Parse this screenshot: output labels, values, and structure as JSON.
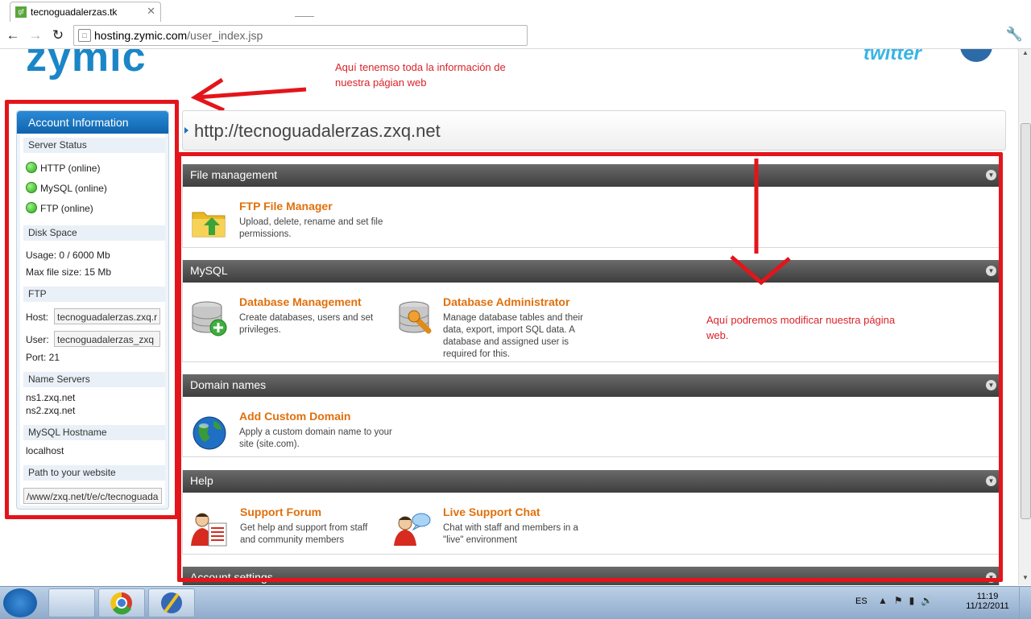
{
  "browser": {
    "tab_title": "tecnoguadalerzas.tk",
    "url_host": "hosting.zymic.com",
    "url_path": "/user_index.jsp"
  },
  "header": {
    "logo_text": "zymic",
    "twitter_text": "twitter"
  },
  "sidebar": {
    "title": "Account Information",
    "server_status_label": "Server Status",
    "services": [
      "HTTP (online)",
      "MySQL (online)",
      "FTP (online)"
    ],
    "disk_space_label": "Disk Space",
    "usage": "Usage:  0 / 6000 Mb",
    "max_file_size": "Max file size:  15 Mb",
    "ftp_label": "FTP",
    "host_label": "Host:",
    "host_value": "tecnoguadalerzas.zxq.r",
    "user_label": "User:",
    "user_value": "tecnoguadalerzas_zxq",
    "port": "Port:  21",
    "name_servers_label": "Name Servers",
    "ns1": "ns1.zxq.net",
    "ns2": "ns2.zxq.net",
    "mysql_hostname_label": "MySQL Hostname",
    "mysql_hostname": "localhost",
    "path_label": "Path to your website",
    "path_value": "/www/zxq.net/t/e/c/tecnoguada"
  },
  "main": {
    "site_url": "http://tecnoguadalerzas.zxq.net",
    "sections": {
      "file_management": {
        "title": "File management",
        "items": [
          {
            "title": "FTP File Manager",
            "desc": "Upload, delete, rename and set file permissions."
          }
        ]
      },
      "mysql": {
        "title": "MySQL",
        "items": [
          {
            "title": "Database Management",
            "desc": "Create databases, users and set privileges."
          },
          {
            "title": "Database Administrator",
            "desc": "Manage database tables and their data, export, import SQL data. A database and assigned user is required for this."
          }
        ]
      },
      "domain_names": {
        "title": "Domain names",
        "items": [
          {
            "title": "Add Custom Domain",
            "desc": "Apply a custom domain name to your site (site.com)."
          }
        ]
      },
      "help": {
        "title": "Help",
        "items": [
          {
            "title": "Support Forum",
            "desc": "Get help and support from staff and community members"
          },
          {
            "title": "Live Support Chat",
            "desc": "Chat with staff and members in a \"live\" environment"
          }
        ]
      },
      "account_settings": {
        "title": "Account settings"
      }
    }
  },
  "annotations": {
    "top": "Aquí tenemso toda la información de nuestra págian web",
    "right": "Aquí podremos modificar nuestra página web."
  },
  "taskbar": {
    "language": "ES",
    "time": "11:19",
    "date": "11/12/2011"
  }
}
